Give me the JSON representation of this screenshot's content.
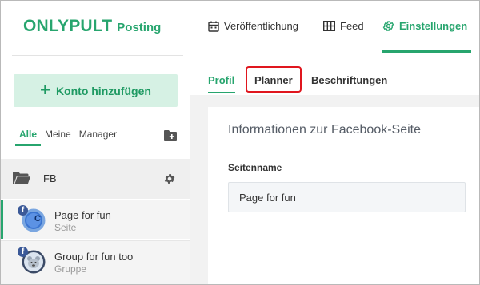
{
  "app": {
    "logo_main": "ONLYPULT",
    "logo_sub": "Posting"
  },
  "sidebar": {
    "add_account_label": "Konto hinzufügen",
    "filter_tabs": [
      {
        "label": "Alle",
        "active": true
      },
      {
        "label": "Meine",
        "active": false
      },
      {
        "label": "Manager",
        "active": false
      }
    ],
    "group": {
      "label": "FB"
    },
    "accounts": [
      {
        "name": "Page for fun",
        "type": "Seite",
        "network": "f",
        "avatar_letter": "C",
        "selected": true
      },
      {
        "name": "Group for fun too",
        "type": "Gruppe",
        "network": "f",
        "selected": false
      }
    ]
  },
  "topnav": {
    "items": [
      {
        "label": "Veröffentlichung",
        "icon": "calendar-icon",
        "active": false
      },
      {
        "label": "Feed",
        "icon": "grid-icon",
        "active": false
      },
      {
        "label": "Einstellungen",
        "icon": "gear-icon",
        "active": true
      }
    ]
  },
  "subtabs": [
    {
      "label": "Profil",
      "active": true
    },
    {
      "label": "Planner",
      "active": false,
      "highlighted": true
    },
    {
      "label": "Beschriftungen",
      "active": false
    }
  ],
  "card": {
    "title": "Informationen zur Facebook-Seite",
    "field_label": "Seitenname",
    "field_value": "Page for fun"
  },
  "colors": {
    "accent": "#27a56e",
    "highlight": "#e0161e",
    "facebook": "#3b5998"
  }
}
